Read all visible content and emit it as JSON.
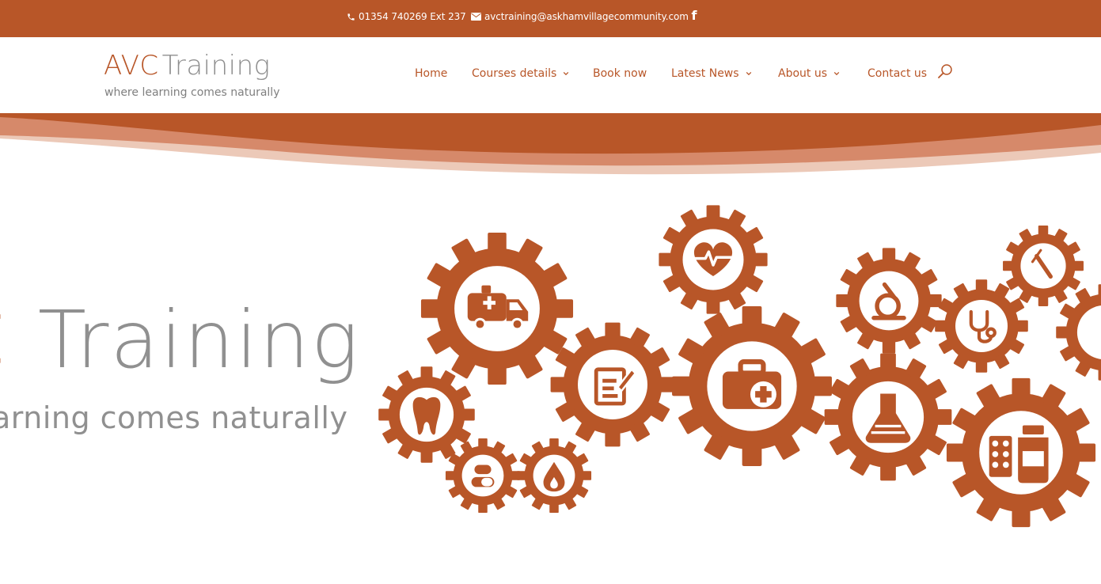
{
  "topbar": {
    "phone": "01354 740269 Ext 237",
    "email": "avctraining@askhamvillagecommunity.com",
    "facebook_glyph": "f",
    "phone_icon": "phone-icon",
    "email_icon": "envelope-icon"
  },
  "logo": {
    "avc": "AVC",
    "training": "Training",
    "tagline": "where learning comes naturally"
  },
  "nav": {
    "items": [
      {
        "label": "Home",
        "dropdown": false
      },
      {
        "label": "Courses details",
        "dropdown": true
      },
      {
        "label": "Book now",
        "dropdown": false
      },
      {
        "label": "Latest News",
        "dropdown": true
      },
      {
        "label": "About us",
        "dropdown": true
      },
      {
        "label": "Contact us",
        "dropdown": false
      }
    ],
    "search_icon": "search-icon"
  },
  "hero": {
    "title_c": "C",
    "title_training": "Training",
    "tagline": "arning comes naturally",
    "gear_icons": [
      "ambulance-icon",
      "heartbeat-icon",
      "microscope-icon",
      "syringe-icon",
      "clipboard-icon",
      "medical-bag-icon",
      "stethoscope-icon",
      "tooth-icon",
      "flask-icon",
      "pill-icon",
      "drop-icon",
      "medicine-bottle-icon"
    ]
  },
  "colors": {
    "brand": "#b85628",
    "grey_text": "#909090",
    "wave_light": "#d6896a",
    "wave_pale": "#ecc9b8"
  }
}
